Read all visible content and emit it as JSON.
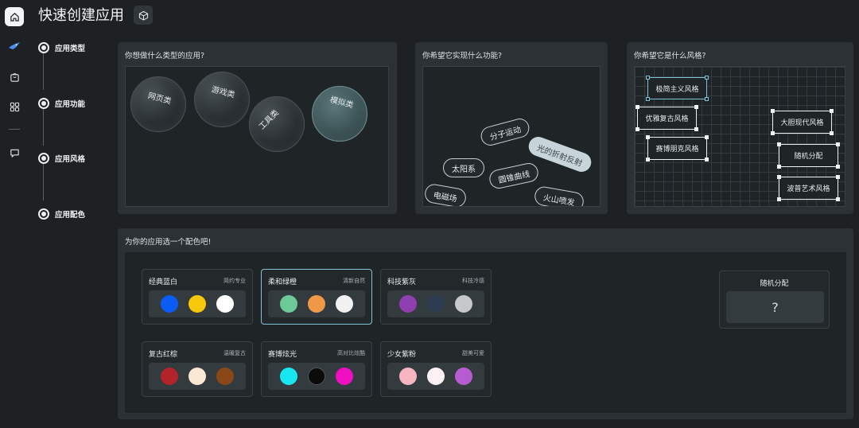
{
  "header": {
    "title": "快速创建应用",
    "cube_icon": "cube-icon"
  },
  "rail": {
    "icons": [
      "home-icon",
      "rocket-icon",
      "bag-icon",
      "apps-icon",
      "chat-icon"
    ]
  },
  "steps": [
    {
      "label": "应用类型"
    },
    {
      "label": "应用功能"
    },
    {
      "label": "应用风格"
    },
    {
      "label": "应用配色"
    }
  ],
  "type_panel": {
    "title": "你想做什么类型的应用?",
    "bubbles": [
      {
        "label": "网页类",
        "selected": false
      },
      {
        "label": "游戏类",
        "selected": false
      },
      {
        "label": "工具类",
        "selected": false
      },
      {
        "label": "模拟类",
        "selected": true
      }
    ]
  },
  "function_panel": {
    "title": "你希望它实现什么功能?",
    "pills": [
      {
        "label": "分子运动",
        "selected": false
      },
      {
        "label": "光的折射反射",
        "selected": true
      },
      {
        "label": "太阳系",
        "selected": false
      },
      {
        "label": "圆锥曲线",
        "selected": false
      },
      {
        "label": "电磁场",
        "selected": false
      },
      {
        "label": "火山喷发",
        "selected": false
      }
    ]
  },
  "style_panel": {
    "title": "你希望它是什么风格?",
    "styles": [
      {
        "label": "极简主义风格",
        "selected": true
      },
      {
        "label": "优雅复古风格",
        "selected": false
      },
      {
        "label": "赛博朋克风格",
        "selected": false
      },
      {
        "label": "大胆现代风格",
        "selected": false
      },
      {
        "label": "随机分配",
        "selected": false
      },
      {
        "label": "波普艺术风格",
        "selected": false
      }
    ]
  },
  "palette_panel": {
    "title": "为你的应用选一个配色吧!",
    "palettes": [
      {
        "name": "经典蓝白",
        "desc": "简约专业",
        "colors": [
          "#0a5cf5",
          "#f7c80a",
          "#ffffff"
        ],
        "selected": false
      },
      {
        "name": "柔和绿橙",
        "desc": "清新自然",
        "colors": [
          "#6cc998",
          "#ef9848",
          "#f1f1f1"
        ],
        "selected": true
      },
      {
        "name": "科技紫灰",
        "desc": "科技冷感",
        "colors": [
          "#8f3fb0",
          "#2d3b50",
          "#c6c8ca"
        ],
        "selected": false
      },
      {
        "name": "复古红棕",
        "desc": "温暖复古",
        "colors": [
          "#b2242a",
          "#fbe8d2",
          "#8a4718"
        ],
        "selected": false
      },
      {
        "name": "赛博炫光",
        "desc": "高对比炫酷",
        "colors": [
          "#18e7f1",
          "#0b0b0b",
          "#ef0ec0"
        ],
        "selected": false
      },
      {
        "name": "少女紫粉",
        "desc": "甜美可爱",
        "colors": [
          "#f7b5c1",
          "#fdf1f4",
          "#b75bd0"
        ],
        "selected": false
      }
    ],
    "random": {
      "label": "随机分配",
      "symbol": "?"
    }
  }
}
